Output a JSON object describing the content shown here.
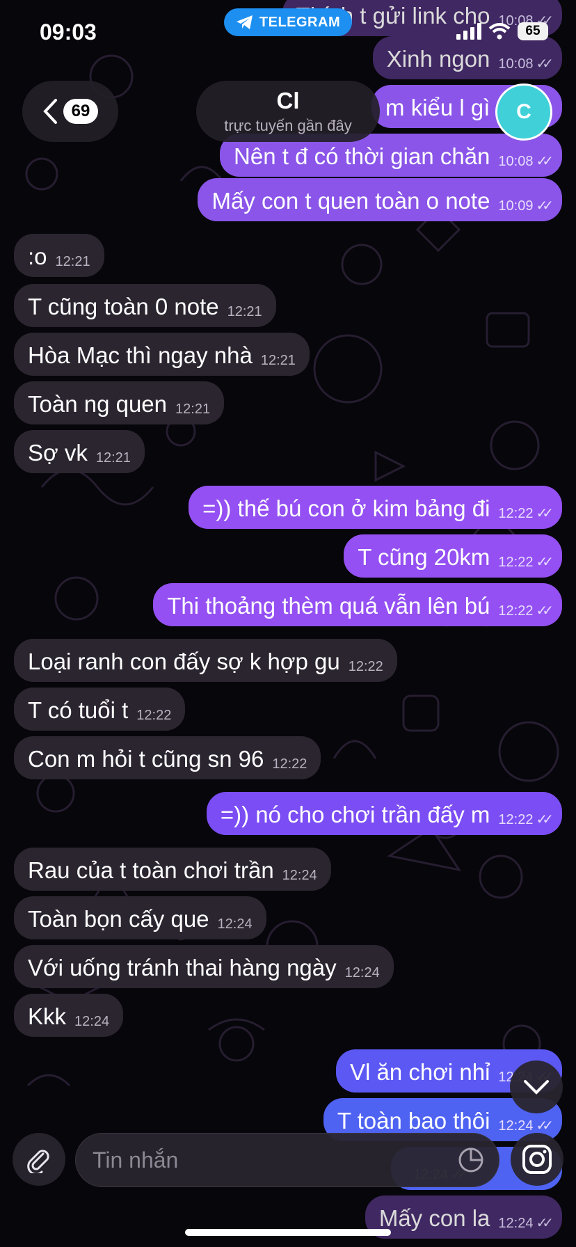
{
  "status_bar": {
    "time": "09:03",
    "app_pill": "TELEGRAM",
    "battery": "65"
  },
  "header": {
    "back_count": "69",
    "chat_name": "Cl",
    "chat_status": "trực tuyến gần đây",
    "avatar_letter": "C"
  },
  "messages": [
    {
      "dir": "out",
      "style": "out-faded",
      "text": "Thích t gửi link cho",
      "time": "10:08",
      "checks": true
    },
    {
      "dir": "out",
      "style": "out-faded",
      "text": "Xinh ngon",
      "time": "10:08",
      "checks": true
    },
    {
      "dir": "out",
      "style": "out-purple-1",
      "text": "m kiểu l gì",
      "time": "10:08",
      "checks": true
    },
    {
      "dir": "out",
      "style": "out-purple-1",
      "text": "Nên t đ có thời gian chăn",
      "time": "10:08",
      "checks": true
    },
    {
      "dir": "out",
      "style": "out-purple-1",
      "text": "Mấy con t quen toàn o note",
      "time": "10:09",
      "checks": true
    },
    {
      "dir": "in",
      "text": ":o",
      "time": "12:21"
    },
    {
      "dir": "in",
      "text": "T cũng toàn 0 note",
      "time": "12:21"
    },
    {
      "dir": "in",
      "text": "Hòa Mạc thì ngay nhà",
      "time": "12:21"
    },
    {
      "dir": "in",
      "text": "Toàn ng quen",
      "time": "12:21"
    },
    {
      "dir": "in",
      "text": "Sợ vk",
      "time": "12:21"
    },
    {
      "dir": "out",
      "style": "out-purple-2",
      "text": "=)) thế bú con ở kim bảng đi",
      "time": "12:22",
      "checks": true
    },
    {
      "dir": "out",
      "style": "out-purple-2",
      "text": "T cũng 20km",
      "time": "12:22",
      "checks": true
    },
    {
      "dir": "out",
      "style": "out-purple-2",
      "text": "Thi thoảng thèm quá vẫn lên bú",
      "time": "12:22",
      "checks": true
    },
    {
      "dir": "in",
      "text": "Loại ranh con đấy sợ k hợp gu",
      "time": "12:22"
    },
    {
      "dir": "in",
      "text": "T có tuổi t",
      "time": "12:22"
    },
    {
      "dir": "in",
      "text": "Con m hỏi t cũng sn 96",
      "time": "12:22"
    },
    {
      "dir": "out",
      "style": "out-violet",
      "text": "=)) nó cho chơi trần đấy m",
      "time": "12:22",
      "checks": true
    },
    {
      "dir": "in",
      "text": "Rau của t toàn chơi trần",
      "time": "12:24"
    },
    {
      "dir": "in",
      "text": "Toàn bọn cấy que",
      "time": "12:24"
    },
    {
      "dir": "in",
      "text": "Với uống tránh thai hàng ngày",
      "time": "12:24"
    },
    {
      "dir": "in",
      "text": "Kkk",
      "time": "12:24"
    },
    {
      "dir": "out",
      "style": "out-blue",
      "text": "Vl ăn chơi nhỉ",
      "time": "12:24",
      "checks": true
    },
    {
      "dir": "out",
      "style": "out-blue2",
      "text": "T toàn bao thôi",
      "time": "12:24",
      "checks": true
    },
    {
      "dir": "out",
      "style": "out-blue2",
      "text": "",
      "time": "12:24",
      "checks": true
    },
    {
      "dir": "out",
      "style": "out-faded",
      "text": "Mấy con la",
      "time": "12:24",
      "checks": true
    }
  ],
  "composer": {
    "placeholder": "Tin nhắn"
  },
  "icons": {
    "back": "chevron-left-icon",
    "attach": "paperclip-icon",
    "sticker": "sticker-icon",
    "camera": "instagram-camera-icon",
    "scroll": "chevron-down-icon",
    "telegram": "telegram-plane-icon"
  },
  "colors": {
    "background": "#07060a",
    "incoming": "#2b2530",
    "outgoing": "#9450f2",
    "outgoing_blue": "#5c58f4",
    "avatar": "#3fd0d8",
    "telegram_pill": "#1d8ff0"
  }
}
